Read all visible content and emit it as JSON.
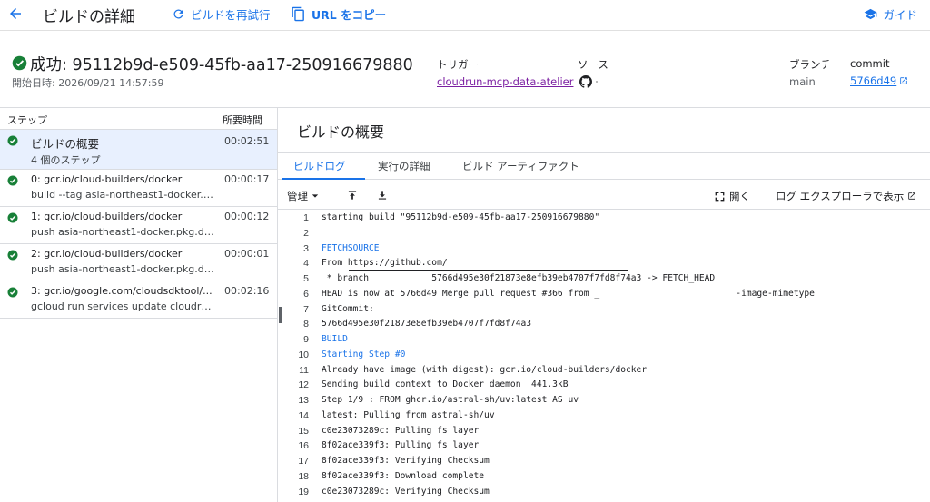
{
  "topbar": {
    "title": "ビルドの詳細",
    "rebuild_label": "ビルドを再試行",
    "copy_url_label": "URL をコピー",
    "guide_label": "ガイド"
  },
  "header": {
    "build_title": "成功: 95112b9d-e509-45fb-aa17-250916679880",
    "start_time": "開始日時: 2026/09/21 14:57:59",
    "trigger_label": "トリガー",
    "trigger_value": "cloudrun-mcp-data-atelier",
    "source_label": "ソース",
    "branch_label": "ブランチ",
    "branch_value": "main",
    "commit_label": "commit",
    "commit_value": "5766d49"
  },
  "steps": {
    "header_step": "ステップ",
    "header_duration": "所要時間",
    "items": [
      {
        "name": "ビルドの概要",
        "sub": "4 個のステップ",
        "duration": "00:02:51"
      },
      {
        "name": "0: gcr.io/cloud-builders/docker",
        "sub": "build --tag asia-northeast1-docker.p...",
        "duration": "00:00:17"
      },
      {
        "name": "1: gcr.io/cloud-builders/docker",
        "sub": "push asia-northeast1-docker.pkg.de...",
        "duration": "00:00:12"
      },
      {
        "name": "2: gcr.io/cloud-builders/docker",
        "sub": "push asia-northeast1-docker.pkg.de...",
        "duration": "00:00:01"
      },
      {
        "name": "3: gcr.io/google.com/cloudsdktool/...",
        "sub": "gcloud run services update cloudru...",
        "duration": "00:02:16"
      }
    ]
  },
  "main": {
    "title": "ビルドの概要",
    "tabs": [
      "ビルドログ",
      "実行の詳細",
      "ビルド アーティファクト"
    ],
    "manage_label": "管理",
    "open_label": "開く",
    "log_explorer_label": "ログ エクスプローラで表示"
  },
  "log": {
    "accent_color": "#1a73e8",
    "lines": [
      {
        "n": "1",
        "text": "starting build \"95112b9d-e509-45fb-aa17-250916679880\"",
        "blue": false
      },
      {
        "n": "2",
        "text": "",
        "blue": false
      },
      {
        "n": "3",
        "text": "FETCHSOURCE",
        "blue": true
      },
      {
        "n": "4",
        "text": "From https://github.com/",
        "blue": false
      },
      {
        "n": "5",
        "text": " * branch            5766d495e30f21873e8efb39eb4707f7fd8f74a3 -> FETCH_HEAD",
        "blue": false
      },
      {
        "n": "6",
        "text": "HEAD is now at 5766d49 Merge pull request #366 from _                          -image-mimetype",
        "blue": false
      },
      {
        "n": "7",
        "text": "GitCommit:",
        "blue": false
      },
      {
        "n": "8",
        "text": "5766d495e30f21873e8efb39eb4707f7fd8f74a3",
        "blue": false
      },
      {
        "n": "9",
        "text": "BUILD",
        "blue": true
      },
      {
        "n": "10",
        "text": "Starting Step #0",
        "blue": true
      },
      {
        "n": "11",
        "text": "Already have image (with digest): gcr.io/cloud-builders/docker",
        "blue": false
      },
      {
        "n": "12",
        "text": "Sending build context to Docker daemon  441.3kB",
        "blue": false
      },
      {
        "n": "13",
        "text": "Step 1/9 : FROM ghcr.io/astral-sh/uv:latest AS uv",
        "blue": false
      },
      {
        "n": "14",
        "text": "latest: Pulling from astral-sh/uv",
        "blue": false
      },
      {
        "n": "15",
        "text": "c0e23073289c: Pulling fs layer",
        "blue": false
      },
      {
        "n": "16",
        "text": "8f02ace339f3: Pulling fs layer",
        "blue": false
      },
      {
        "n": "17",
        "text": "8f02ace339f3: Verifying Checksum",
        "blue": false
      },
      {
        "n": "18",
        "text": "8f02ace339f3: Download complete",
        "blue": false
      },
      {
        "n": "19",
        "text": "c0e23073289c: Verifying Checksum",
        "blue": false
      }
    ]
  }
}
